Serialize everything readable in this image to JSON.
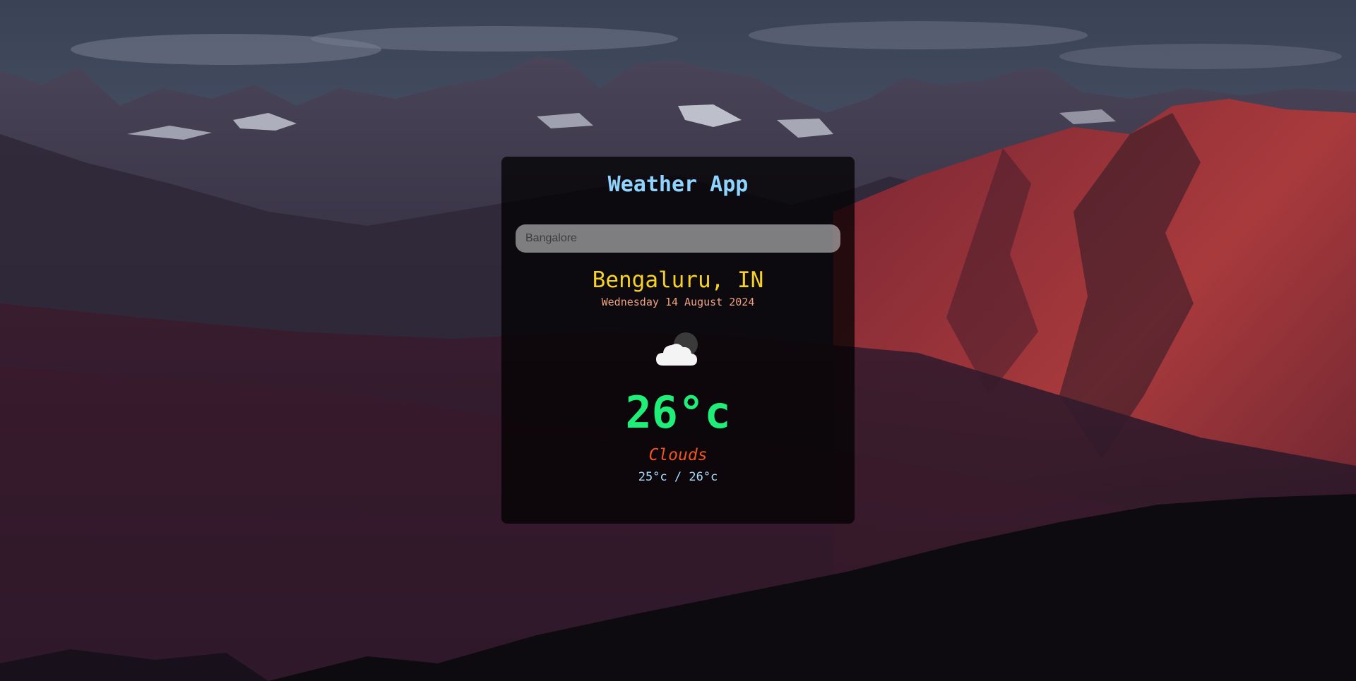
{
  "app": {
    "title": "Weather App"
  },
  "search": {
    "placeholder": "Bangalore",
    "value": ""
  },
  "location": {
    "city": "Bengaluru, IN",
    "date": "Wednesday 14 August 2024"
  },
  "weather": {
    "icon": "cloud-moon-icon",
    "temperature": "26°c",
    "condition": "Clouds",
    "min_max": "25°c / 26°c"
  },
  "colors": {
    "title": "#8fd3ff",
    "city": "#f6d226",
    "date": "#f0a080",
    "temperature": "#1fef78",
    "condition": "#f0551f",
    "min_max": "#a9ddff",
    "card_background": "rgba(0,0,0,0.74)"
  },
  "background": {
    "icon": "mountain-landscape-image"
  }
}
